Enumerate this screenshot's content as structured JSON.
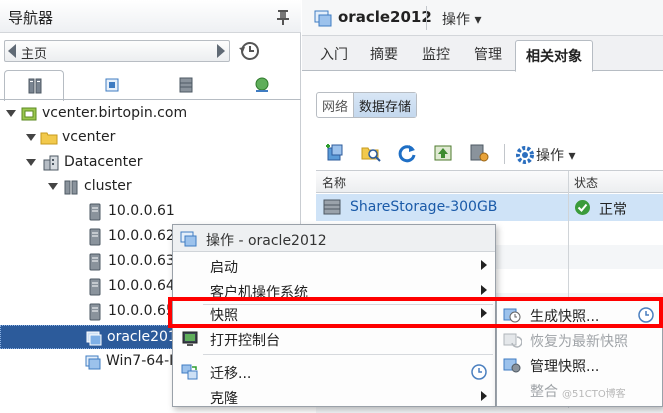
{
  "navigator": {
    "title": "导航器",
    "back_label": "主页",
    "tabs": [
      {
        "name": "hosts-and-clusters-tab",
        "icon": "hosts-clusters-icon",
        "active": true
      },
      {
        "name": "vms-and-templates-tab",
        "icon": "vms-templates-icon",
        "active": false
      },
      {
        "name": "storage-tab",
        "icon": "storage-icon",
        "active": false
      },
      {
        "name": "networking-tab",
        "icon": "network-icon",
        "active": false
      }
    ],
    "tree": {
      "vcenter_server": "vcenter.birtopin.com",
      "folder": "vcenter",
      "datacenter": "Datacenter",
      "cluster": "cluster",
      "hosts": [
        "10.0.0.61",
        "10.0.0.62",
        "10.0.0.63",
        "10.0.0.64",
        "10.0.0.65"
      ],
      "vm_selected": "oracle2012",
      "vm_other": "Win7-64-IP"
    }
  },
  "main": {
    "vm_title": "oracle2012",
    "actions_label": "操作 ▾",
    "tabs": [
      "入门",
      "摘要",
      "监控",
      "管理",
      "相关对象"
    ],
    "active_tab": "相关对象",
    "subtabs": [
      "网络",
      "数据存储"
    ],
    "toolbar_actions": "操作 ▾",
    "grid": {
      "columns": [
        "名称",
        "状态"
      ],
      "rows": [
        {
          "name": "ShareStorage-300GB",
          "status": "正常"
        }
      ]
    }
  },
  "context_menu": {
    "title": "操作 - oracle2012",
    "items": [
      "启动",
      "客户机操作系统",
      "快照",
      "打开控制台",
      "迁移...",
      "克隆"
    ]
  },
  "snapshot_submenu": {
    "items": [
      {
        "label": "生成快照...",
        "enabled": true
      },
      {
        "label": "恢复为最新快照",
        "enabled": false
      },
      {
        "label": "管理快照...",
        "enabled": true
      },
      {
        "label": "整合",
        "enabled": false
      }
    ]
  },
  "watermark": "@51CTO博客",
  "colors": {
    "selection": "#2c5b9b",
    "highlight": "#ff0000",
    "row_selected": "#cfe3f7",
    "status_ok": "#3b9b3b",
    "link": "#1a5aa8"
  }
}
